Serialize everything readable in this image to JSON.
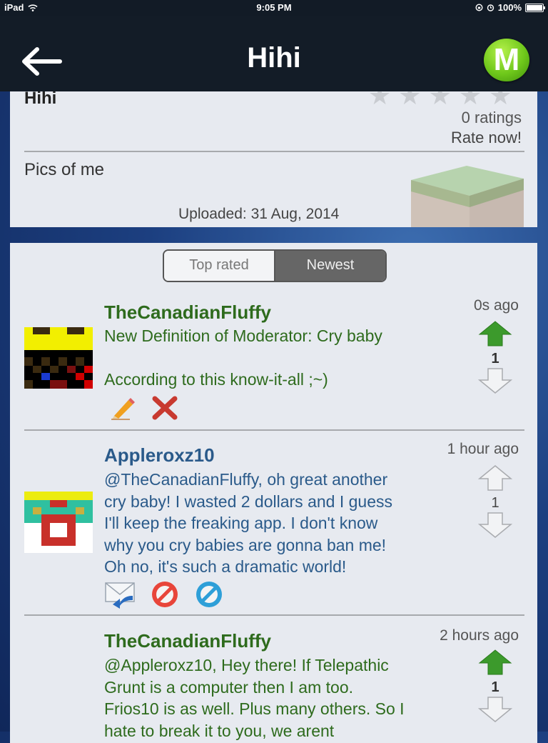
{
  "status_bar": {
    "device": "iPad",
    "time": "9:05 PM",
    "battery": "100%"
  },
  "nav": {
    "title": "Hihi",
    "back_icon": "back-arrow-icon",
    "logo_letter": "M"
  },
  "info": {
    "title": "Hihi",
    "ratings": "0 ratings",
    "rate_now": "Rate now!",
    "description": "Pics of me",
    "uploaded": "Uploaded: 31 Aug, 2014"
  },
  "tabs": {
    "top_rated": "Top rated",
    "newest": "Newest",
    "selected": "Newest"
  },
  "comments": [
    {
      "author": "TheCanadianFluffy",
      "time": "0s ago",
      "lines": [
        "New Definition of Moderator: Cry baby",
        "",
        "According to this know-it-all ;~)"
      ],
      "votes": "1",
      "upvoted": true,
      "actions": [
        "edit-pencil-icon",
        "delete-x-icon"
      ],
      "color": "#2e6b1d"
    },
    {
      "author": "Appleroxz10",
      "time": "1 hour ago",
      "lines": [
        "@TheCanadianFluffy, oh great another",
        "cry baby! I wasted 2 dollars and I guess",
        "I'll keep the freaking app. I don't know",
        "why you cry babies are gonna ban me!",
        "Oh no, it's such a dramatic world!"
      ],
      "votes": "1",
      "upvoted": false,
      "actions": [
        "reply-mail-icon",
        "report-block-icon",
        "ban-icon"
      ],
      "color": "#2a5a8a"
    },
    {
      "author": "TheCanadianFluffy",
      "time": "2 hours ago",
      "lines": [
        "@Appleroxz10, Hey there! If Telepathic",
        "Grunt is a computer then I am too.",
        "Frios10 is as well. Plus many others. So I",
        "hate to break it to you, we arent"
      ],
      "votes": "1",
      "upvoted": true,
      "color": "#2e6b1d"
    }
  ]
}
